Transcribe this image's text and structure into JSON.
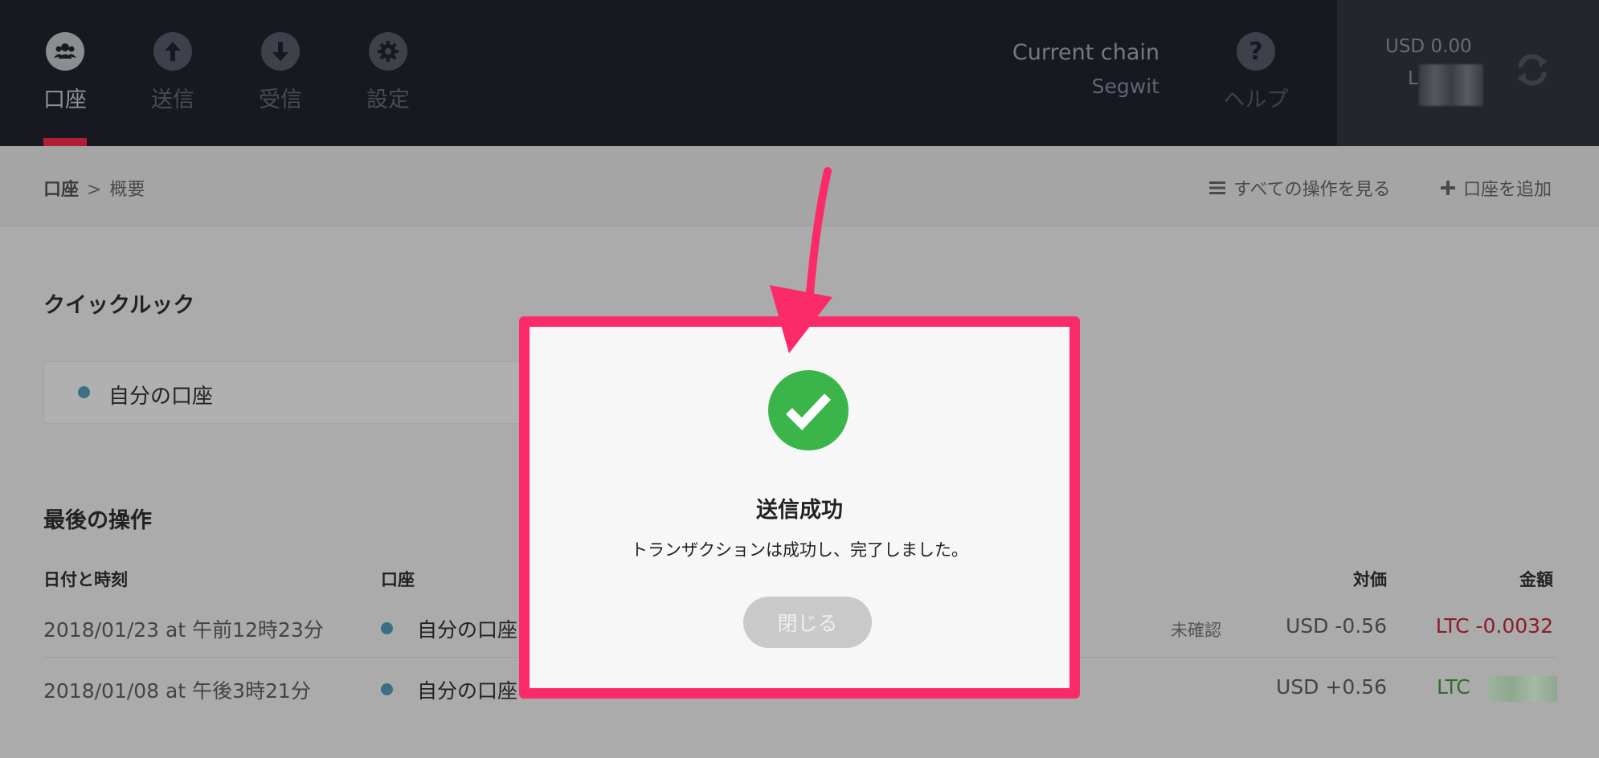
{
  "nav": {
    "items": [
      {
        "label": "口座",
        "icon": "users-icon"
      },
      {
        "label": "送信",
        "icon": "arrow-up-icon"
      },
      {
        "label": "受信",
        "icon": "arrow-down-icon"
      },
      {
        "label": "設定",
        "icon": "gear-icon"
      }
    ],
    "chain_title": "Current chain",
    "chain_value": "Segwit",
    "help_label": "ヘルプ",
    "help_glyph": "?",
    "balance_usd": "USD 0.00",
    "balance_ltc_prefix": "L"
  },
  "breadcrumb": {
    "root": "口座",
    "separator": ">",
    "current": "概要"
  },
  "actions": {
    "view_all": "すべての操作を見る",
    "add_account": "口座を追加"
  },
  "quick_look": {
    "title": "クイックルック",
    "account_name": "自分の口座"
  },
  "last_ops": {
    "title": "最後の操作",
    "headers": {
      "datetime": "日付と時刻",
      "account": "口座",
      "value": "対価",
      "amount": "金額"
    },
    "rows": [
      {
        "datetime": "2018/01/23 at 午前12時23分",
        "account": "自分の口座",
        "status": "未確認",
        "value": "USD -0.56",
        "amount": "LTC -0.0032"
      },
      {
        "datetime": "2018/01/08 at 午後3時21分",
        "account": "自分の口座",
        "status": "",
        "value": "USD +0.56",
        "amount": "LTC"
      }
    ]
  },
  "modal": {
    "title": "送信成功",
    "message": "トランザクションは成功し、完了しました。",
    "close_label": "閉じる"
  },
  "colors": {
    "highlight": "#fb2b6a",
    "success": "#3bb54a",
    "negative": "#8c1b2b",
    "positive": "#2f6e2f"
  }
}
